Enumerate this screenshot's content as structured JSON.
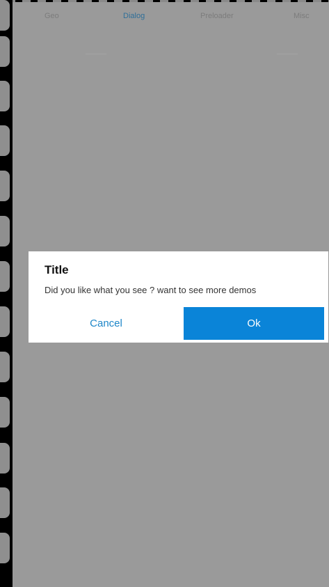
{
  "tabs": [
    {
      "label": "Geo"
    },
    {
      "label": "Dialog"
    },
    {
      "label": "Preloader"
    },
    {
      "label": "Misc"
    }
  ],
  "active_tab": "Dialog",
  "dialog": {
    "title": "Title",
    "message": "Did you like what you see ? want to see more demos",
    "cancel_label": "Cancel",
    "ok_label": "Ok"
  },
  "colors": {
    "overlay": "#9a9a9a",
    "accent": "#0a84d8",
    "cancel_text": "#1d86c8",
    "active_tab": "#2f6f99"
  }
}
